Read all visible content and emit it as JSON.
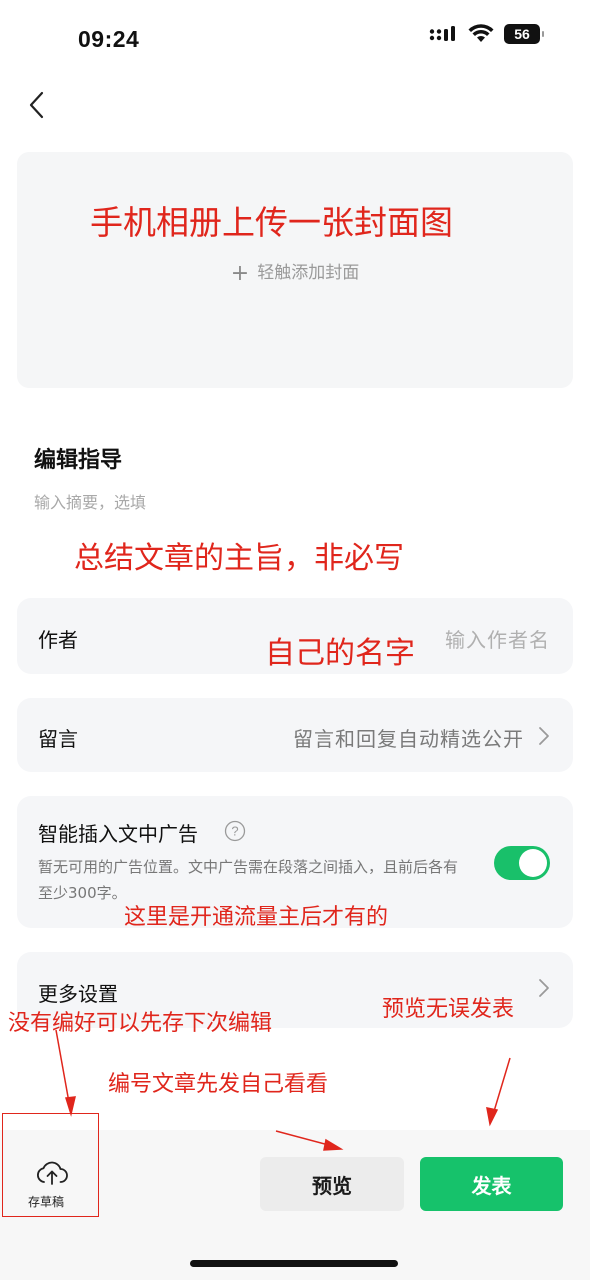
{
  "status_bar": {
    "time": "09:24",
    "battery": "56"
  },
  "cover": {
    "add_label": "轻触添加封面",
    "annotation": "手机相册上传一张封面图"
  },
  "guide": {
    "title": "编辑指导",
    "summary_placeholder": "输入摘要，选填",
    "annotation": "总结文章的主旨，非必写"
  },
  "author": {
    "label": "作者",
    "placeholder": "输入作者名",
    "annotation": "自己的名字"
  },
  "comment": {
    "label": "留言",
    "value": "留言和回复自动精选公开"
  },
  "ads": {
    "title": "智能插入文中广告",
    "description": "暂无可用的广告位置。文中广告需在段落之间插入，且前后各有至少300字。",
    "enabled": true,
    "annotation": "这里是开通流量主后才有的"
  },
  "more": {
    "label": "更多设置"
  },
  "annotations": {
    "draft": "没有编好可以先存下次编辑",
    "publish": "预览无误发表",
    "preview": "编号文章先发自己看看"
  },
  "bottom": {
    "draft_label": "存草稿",
    "preview_label": "预览",
    "publish_label": "发表"
  },
  "colors": {
    "accent_green": "#16c26b",
    "annotation_red": "#e0261c"
  }
}
